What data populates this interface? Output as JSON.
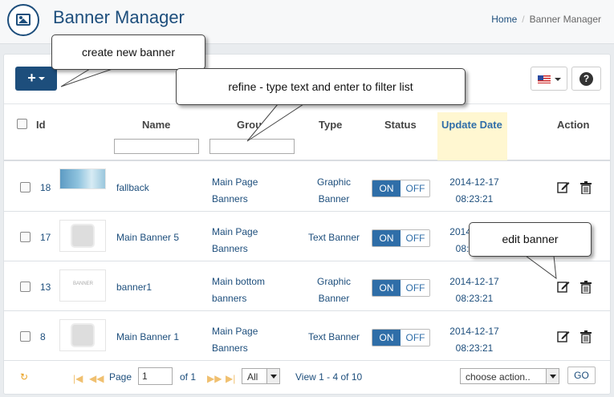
{
  "header": {
    "title": "Banner Manager",
    "breadcrumb": {
      "home": "Home",
      "separator": "/",
      "current": "Banner Manager"
    }
  },
  "toolbar": {
    "add_label": "+"
  },
  "table": {
    "columns": {
      "id": "Id",
      "name": "Name",
      "group": "Group",
      "type": "Type",
      "status": "Status",
      "update": "Update Date",
      "action": "Action"
    },
    "rows": [
      {
        "id": "18",
        "thumb": "wide",
        "name": "fallback",
        "group1": "Main Page",
        "group2": "Banners",
        "type1": "Graphic",
        "type2": "Banner",
        "on": "ON",
        "off": "OFF",
        "date": "2014-12-17",
        "time": "08:23:21"
      },
      {
        "id": "17",
        "thumb": "gray",
        "name": "Main Banner 5",
        "group1": "Main Page",
        "group2": "Banners",
        "type1": "Text Banner",
        "type2": "",
        "on": "ON",
        "off": "OFF",
        "date": "2014-12-17",
        "time": "08:23:21"
      },
      {
        "id": "13",
        "thumb": "txt",
        "thumb_text": "BANNER",
        "name": "banner1",
        "group1": "Main bottom",
        "group2": "banners",
        "type1": "Graphic",
        "type2": "Banner",
        "on": "ON",
        "off": "OFF",
        "date": "2014-12-17",
        "time": "08:23:21"
      },
      {
        "id": "8",
        "thumb": "gray",
        "name": "Main Banner 1",
        "group1": "Main Page",
        "group2": "Banners",
        "type1": "Text Banner",
        "type2": "",
        "on": "ON",
        "off": "OFF",
        "date": "2014-12-17",
        "time": "08:23:21"
      }
    ]
  },
  "pager": {
    "refresh": "↻",
    "first": "|◀",
    "prev": "◀◀",
    "page_label": "Page",
    "page_value": "1",
    "of_label": "of 1",
    "next": "▶▶",
    "last": "▶|",
    "rows_select": "All",
    "view_text": "View 1 - 4 of 10",
    "action_select": "choose action..",
    "go": "GO"
  },
  "callouts": {
    "create": "create new banner",
    "refine": "refine - type text and enter to filter list",
    "edit": "edit banner"
  },
  "colors": {
    "brand": "#1d4e7c",
    "toggle_on": "#2f6ea8",
    "highlight": "#fff7d1"
  }
}
